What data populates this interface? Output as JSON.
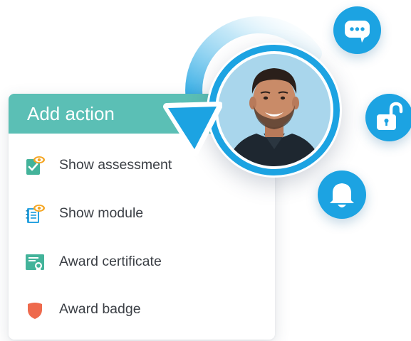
{
  "action_menu": {
    "title": "Add action",
    "items": [
      {
        "label": "Show assessment",
        "icon": "assessment-eye-icon",
        "color": "#43b39a"
      },
      {
        "label": "Show module",
        "icon": "module-eye-icon",
        "color": "#2aa3e0"
      },
      {
        "label": "Award certificate",
        "icon": "certificate-icon",
        "color": "#43b39a"
      },
      {
        "label": "Award badge",
        "icon": "badge-shield-icon",
        "color": "#ee6a4d"
      }
    ],
    "header_color": "#5bbfb5"
  },
  "floating_buttons": [
    {
      "icon": "chat-icon"
    },
    {
      "icon": "unlock-icon"
    },
    {
      "icon": "bell-icon"
    }
  ],
  "accent_color": "#1ca3e2"
}
